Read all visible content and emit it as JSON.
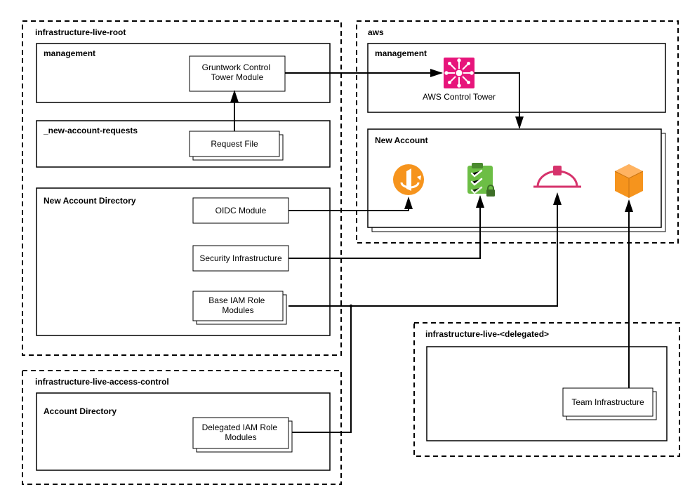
{
  "root": {
    "title": "infrastructure-live-root",
    "management": {
      "title": "management",
      "gruntwork_module": "Gruntwork Control Tower Module"
    },
    "new_account_requests": {
      "title": "_new-account-requests",
      "request_file": "Request File"
    },
    "new_account_directory": {
      "title": "New Account Directory",
      "oidc_module": "OIDC Module",
      "security_infrastructure": "Security Infrastructure",
      "base_iam_role_modules": "Base IAM Role Modules"
    }
  },
  "access_control": {
    "title": "infrastructure-live-access-control",
    "account_directory": {
      "title": "Account Directory",
      "delegated_iam_role_modules": "Delegated IAM Role Modules"
    }
  },
  "aws": {
    "title": "aws",
    "management": {
      "title": "management",
      "control_tower_label": "AWS Control Tower"
    },
    "new_account": {
      "title": "New Account"
    }
  },
  "delegated": {
    "title": "infrastructure-live-<delegated>",
    "team_infrastructure": "Team Infrastructure"
  },
  "icons": {
    "control_tower": "aws-control-tower-icon",
    "oidc": "openid-icon",
    "checklist": "checklist-icon",
    "hardhat": "hardhat-icon",
    "cube": "cube-icon"
  }
}
